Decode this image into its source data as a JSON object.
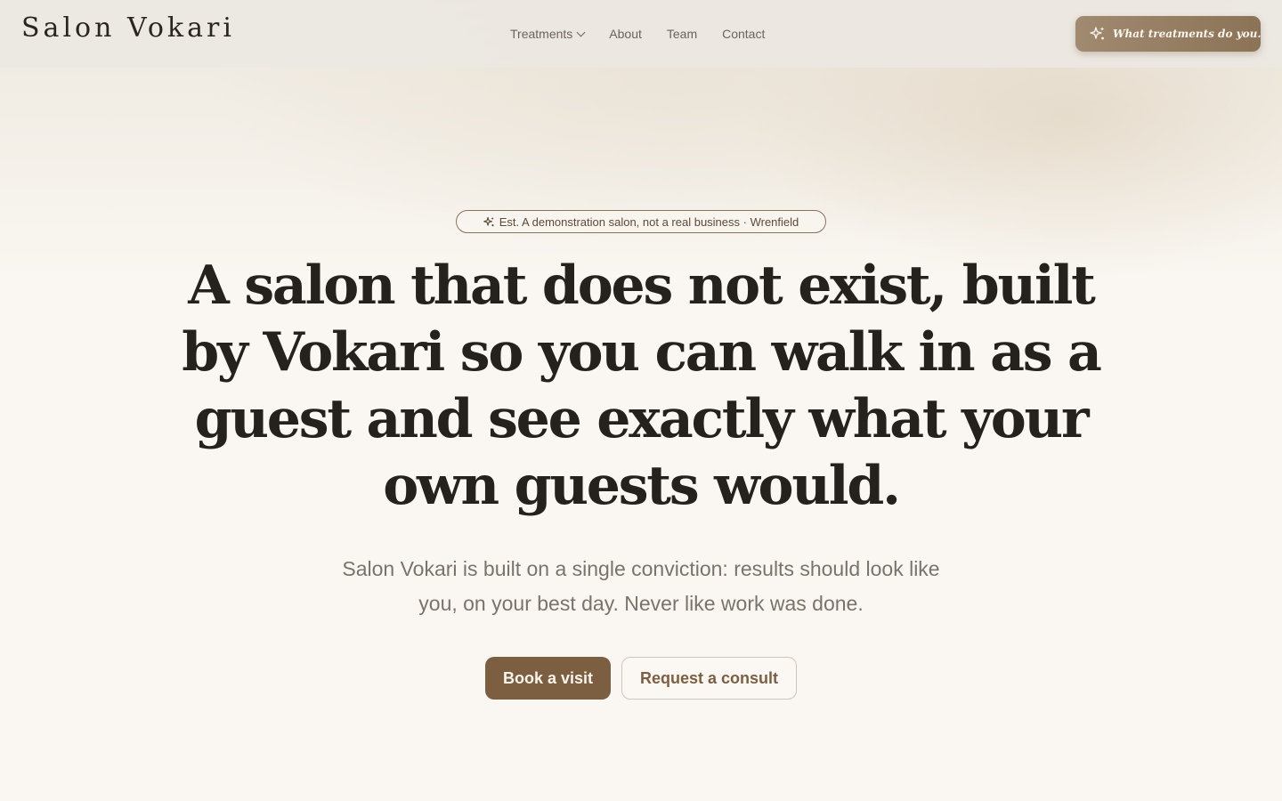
{
  "brand": {
    "name": "Salon Vokari"
  },
  "nav": {
    "items": [
      {
        "label": "Treatments",
        "has_dropdown": true
      },
      {
        "label": "About",
        "has_dropdown": false
      },
      {
        "label": "Team",
        "has_dropdown": false
      },
      {
        "label": "Contact",
        "has_dropdown": false
      }
    ]
  },
  "assistant_button": {
    "label": "What treatments do you...",
    "icon": "sparkle-icon"
  },
  "hero": {
    "badge": "Est. A demonstration salon, not a real business · Wrenfield",
    "badge_icon": "sparkle-icon",
    "headline": "A salon that does not exist, built by Vokari so you can walk in as a guest and see exactly what your own guests would.",
    "lead": "Salon Vokari is built on a single conviction: results should look like you, on your best day. Never like work was done.",
    "primary_cta": "Book a visit",
    "secondary_cta": "Request a consult"
  },
  "colors": {
    "background": "#faf7f2",
    "accent": "#7c5f40",
    "header_bg": "#ece8e2",
    "text_dark": "#25211c",
    "text_muted": "#7a736b"
  }
}
